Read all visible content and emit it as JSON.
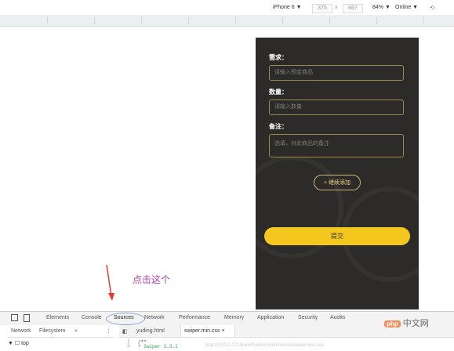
{
  "device_toolbar": {
    "device": "iPhone 6 ▼",
    "width": "375",
    "times": "x",
    "height": "667",
    "zoom": "84% ▼",
    "network": "Online ▼"
  },
  "form": {
    "demand_label": "需求：",
    "demand_placeholder": "请输入预定商品",
    "quantity_label": "数量：",
    "quantity_placeholder": "请输入数量",
    "note_label": "备注：",
    "note_placeholder": "选填，对此商品的备注",
    "add_more": "+ 继续添加",
    "submit": "提交"
  },
  "annotation": "点击这个",
  "devtools": {
    "tabs": [
      "Elements",
      "Console",
      "Sources",
      "Network",
      "Performance",
      "Memory",
      "Application",
      "Security",
      "Audits"
    ],
    "side_tabs": {
      "network": "Network",
      "filesystem": "Filesystem",
      "more": "»"
    },
    "file_tabs": {
      "file1": "yuding.html",
      "file2": "swiper.min.css ×"
    },
    "tree_top": "▼ ☐ top",
    "code_line1": "/**",
    "code_line2": " * Swiper 3.3.1",
    "url_hint": "http://10.0.0.171/pam/Public/common/css/swiper.min.css",
    "line_numbers": "1\n2"
  },
  "watermark": {
    "php": "php",
    "site": "中文网"
  }
}
